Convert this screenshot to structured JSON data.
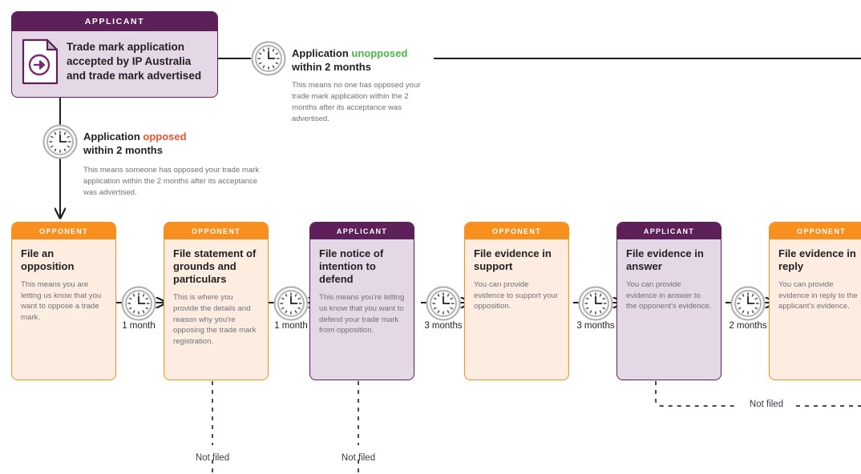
{
  "diagram": {
    "title_bar_labels": {
      "applicant": "APPLICANT",
      "opponent": "OPPONENT"
    },
    "colors": {
      "applicant_header": "#5E2058",
      "applicant_body": "#E4D7E6",
      "opponent_header": "#F7901E",
      "opponent_body": "#FDEDE0",
      "unopposed_highlight": "#4CB748",
      "opposed_highlight": "#F0532B",
      "line": "#231f20",
      "dashed_line": "#4a4a55",
      "body_text": "#6f6f7a"
    }
  },
  "top_card": {
    "role": "APPLICANT",
    "icon": "document-arrow-icon",
    "title": "Trade mark application accepted by IP Australia and trade mark advertised"
  },
  "branches": {
    "unopposed": {
      "icon": "clock-icon",
      "title_prefix": "Application ",
      "title_highlight": "unopposed",
      "title_suffix": "within 2 months",
      "body": "This means no one has opposed your trade mark application within the 2 months after its acceptance was advertised."
    },
    "opposed": {
      "icon": "clock-icon",
      "title_prefix": "Application ",
      "title_highlight": "opposed",
      "title_suffix": "within 2 months",
      "body": "This means someone has opposed your trade mark application within the 2 months after its acceptance was advertised."
    }
  },
  "steps": [
    {
      "role": "OPPONENT",
      "type": "opponent",
      "title": "File an opposition",
      "desc": "This means you are letting us know that you want to oppose a trade mark.",
      "not_filed_label": null
    },
    {
      "role": "OPPONENT",
      "type": "opponent",
      "title": "File statement of grounds and particulars",
      "desc": "This is where you provide the details and reason why you're opposing the trade mark registration.",
      "not_filed_label": "Not filed"
    },
    {
      "role": "APPLICANT",
      "type": "applicant",
      "title": "File notice of intention to defend",
      "desc": "This means you're letting us know that you want to defend your trade mark from opposition.",
      "not_filed_label": "Not filed"
    },
    {
      "role": "OPPONENT",
      "type": "opponent",
      "title": "File evidence in support",
      "desc": "You can provide evidence to support your opposition.",
      "not_filed_label": null
    },
    {
      "role": "APPLICANT",
      "type": "applicant",
      "title": "File evidence in answer",
      "desc": "You can provide evidence in answer to the opponent's evidence.",
      "not_filed_label": "Not filed"
    },
    {
      "role": "OPPONENT",
      "type": "opponent",
      "title": "File evidence in reply",
      "desc": "You can provide evidence in reply to the applicant's evidence.",
      "not_filed_label": null
    }
  ],
  "durations": [
    {
      "label": "1 month",
      "icon": "clock-icon"
    },
    {
      "label": "1 month",
      "icon": "clock-icon"
    },
    {
      "label": "3 months",
      "icon": "clock-icon"
    },
    {
      "label": "3 months",
      "icon": "clock-icon"
    },
    {
      "label": "2 months",
      "icon": "clock-icon"
    }
  ],
  "not_filed_right": {
    "label": "Not filed"
  }
}
